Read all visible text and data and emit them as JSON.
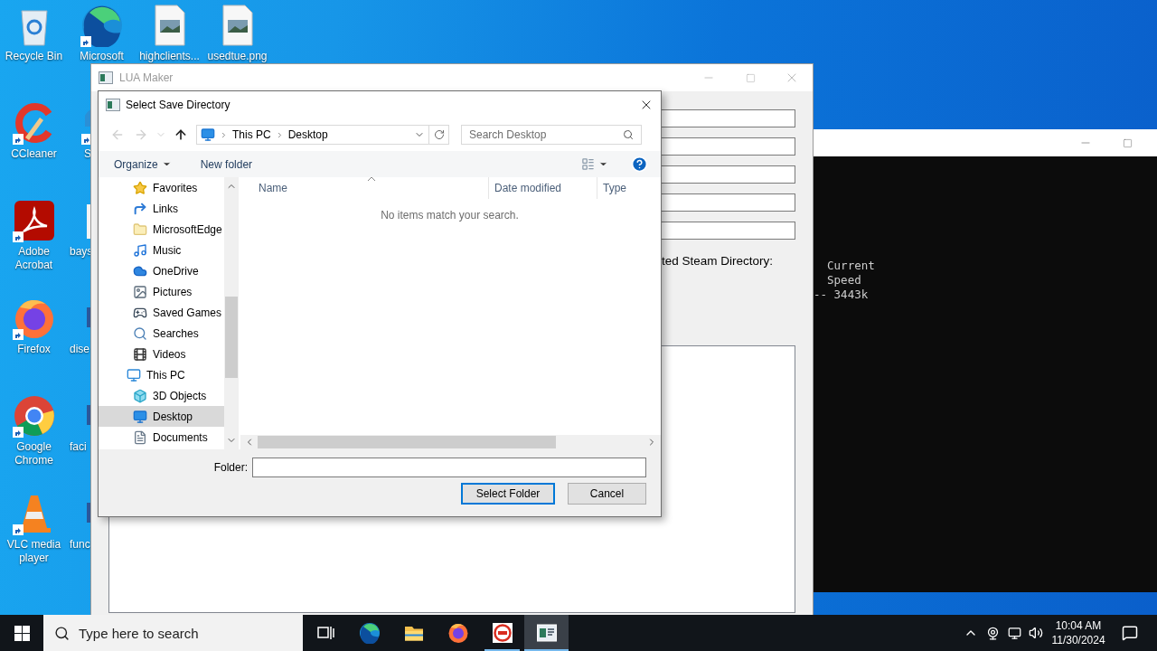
{
  "desktop_icons": {
    "top_row": [
      {
        "label": "Recycle Bin",
        "kind": "recycle-bin",
        "shortcut": false
      },
      {
        "label": "Microsoft",
        "kind": "edge",
        "shortcut": true
      },
      {
        "label": "highclients...",
        "kind": "image-file",
        "shortcut": false
      },
      {
        "label": "usedtue.png",
        "kind": "image-file",
        "shortcut": false
      }
    ],
    "left_column": [
      {
        "label": "CCleaner",
        "kind": "ccleaner",
        "shortcut": true
      },
      {
        "label": "Adobe Acrobat",
        "kind": "acrobat",
        "shortcut": true
      },
      {
        "label": "Firefox",
        "kind": "firefox",
        "shortcut": true
      },
      {
        "label": "Google Chrome",
        "kind": "chrome",
        "shortcut": true
      },
      {
        "label": "VLC media player",
        "kind": "vlc",
        "shortcut": true
      }
    ],
    "second_column": [
      {
        "label": "S",
        "kind": "partial-app",
        "shortcut": true
      },
      {
        "label": "bays",
        "kind": "partial-blank",
        "shortcut": false
      },
      {
        "label": "dise",
        "kind": "partial-doc",
        "shortcut": false
      },
      {
        "label": "faci",
        "kind": "partial-doc",
        "shortcut": false
      },
      {
        "label": "func",
        "kind": "partial-doc",
        "shortcut": false
      }
    ]
  },
  "console_window": {
    "lines": [
      "  Current",
      "  Speed",
      "-- 3443k"
    ]
  },
  "lua_maker": {
    "title": "LUA Maker",
    "text_fields": [
      {
        "kind": "input"
      },
      {
        "kind": "input"
      },
      {
        "kind": "input"
      },
      {
        "kind": "input"
      },
      {
        "kind": "input"
      }
    ],
    "steam_directory_label": "ted Steam Directory:",
    "log_area": {
      "kind": "textarea"
    }
  },
  "dialog": {
    "title": "Select Save Directory",
    "nav_buttons": [
      {
        "kind": "back",
        "disabled": true
      },
      {
        "kind": "forward",
        "disabled": true
      },
      {
        "kind": "recent",
        "disabled": true
      },
      {
        "kind": "up",
        "disabled": false
      }
    ],
    "address": {
      "crumbs": [
        "This PC",
        "Desktop"
      ]
    },
    "search": {
      "placeholder": "Search Desktop"
    },
    "toolbar": {
      "organize": "Organize",
      "new_folder": "New folder"
    },
    "nav_tree": {
      "user_folders": [
        {
          "label": "Favorites",
          "kind": "star",
          "selected": false
        },
        {
          "label": "Links",
          "kind": "link",
          "selected": false
        },
        {
          "label": "MicrosoftEdge",
          "kind": "folder",
          "selected": false
        },
        {
          "label": "Music",
          "kind": "music",
          "selected": false
        },
        {
          "label": "OneDrive",
          "kind": "cloud",
          "selected": false
        },
        {
          "label": "Pictures",
          "kind": "pictures",
          "selected": false
        },
        {
          "label": "Saved Games",
          "kind": "games",
          "selected": false
        },
        {
          "label": "Searches",
          "kind": "search",
          "selected": false
        },
        {
          "label": "Videos",
          "kind": "video",
          "selected": false
        }
      ],
      "roots": [
        {
          "label": "This PC",
          "kind": "pc",
          "selected": false,
          "children": [
            {
              "label": "3D Objects",
              "kind": "cube",
              "selected": false
            },
            {
              "label": "Desktop",
              "kind": "desktop",
              "selected": true
            },
            {
              "label": "Documents",
              "kind": "documents",
              "selected": false
            }
          ]
        }
      ]
    },
    "columns": [
      {
        "label": "Name",
        "sorted": true
      },
      {
        "label": "Date modified",
        "sorted": false
      },
      {
        "label": "Type",
        "sorted": false
      }
    ],
    "empty_message": "No items match your search.",
    "folder_label": "Folder:",
    "buttons": [
      {
        "label": "Select Folder",
        "default": true
      },
      {
        "label": "Cancel",
        "default": false
      }
    ]
  },
  "taskbar": {
    "search": {
      "placeholder": "Type here to search"
    },
    "apps": [
      {
        "kind": "task-view",
        "running": false,
        "selected": false
      },
      {
        "kind": "edge",
        "running": false,
        "selected": false
      },
      {
        "kind": "explorer",
        "running": false,
        "selected": false
      },
      {
        "kind": "firefox",
        "running": false,
        "selected": false
      },
      {
        "kind": "dev-app",
        "running": true,
        "selected": false
      },
      {
        "kind": "form-app",
        "running": true,
        "selected": true
      }
    ],
    "clock": {
      "time": "10:04 AM",
      "date": "11/30/2024"
    }
  }
}
